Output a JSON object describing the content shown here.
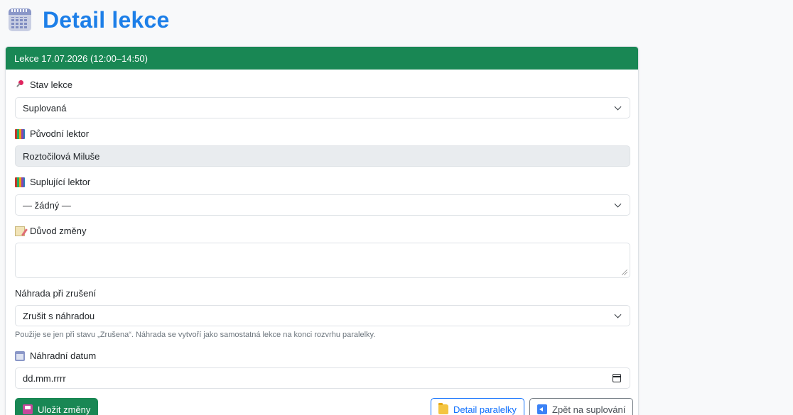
{
  "page": {
    "title": "Detail lekce"
  },
  "card": {
    "header": "Lekce 17.07.2026 (12:00–14:50)"
  },
  "form": {
    "status": {
      "label": "Stav lekce",
      "value": "Suplovaná"
    },
    "original_teacher": {
      "label": "Původní lektor",
      "value": "Roztočilová Miluše"
    },
    "substitute_teacher": {
      "label": "Suplující lektor",
      "value": "— žádný —"
    },
    "reason": {
      "label": "Důvod změny",
      "value": ""
    },
    "cancel_replacement": {
      "label": "Náhrada při zrušení",
      "value": "Zrušit s náhradou",
      "help": "Použije se jen při stavu „Zrušena“. Náhrada se vytvoří jako samostatná lekce na konci rozvrhu paralelky."
    },
    "replacement_date": {
      "label": "Náhradní datum",
      "placeholder": "dd.mm.rrrr"
    }
  },
  "buttons": {
    "save": "Uložit změny",
    "detail": "Detail paralelky",
    "back": "Zpět na suplování"
  },
  "colors": {
    "accent": "#198754",
    "title": "#1d7fe8",
    "link": "#0d6efd"
  }
}
